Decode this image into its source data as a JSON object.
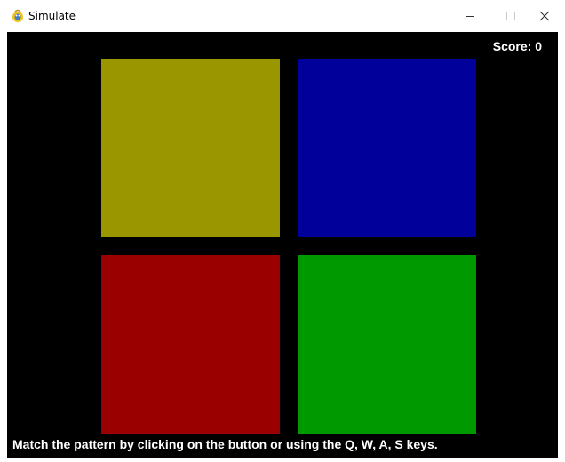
{
  "window": {
    "title": "Simulate",
    "app_icon": "pygame-snake-icon",
    "controls": {
      "minimize_icon": "minimize-icon",
      "maximize_icon": "maximize-icon",
      "close_symbol": "✕"
    }
  },
  "game": {
    "background_color": "#000000",
    "score_text": "Score: 0",
    "pads": [
      {
        "name": "yellow",
        "color": "#9a9600"
      },
      {
        "name": "blue",
        "color": "#02009a"
      },
      {
        "name": "red",
        "color": "#9a0000"
      },
      {
        "name": "green",
        "color": "#009a00"
      }
    ],
    "instructions": "Match the pattern by clicking on the button or using the Q, W, A, S keys."
  }
}
